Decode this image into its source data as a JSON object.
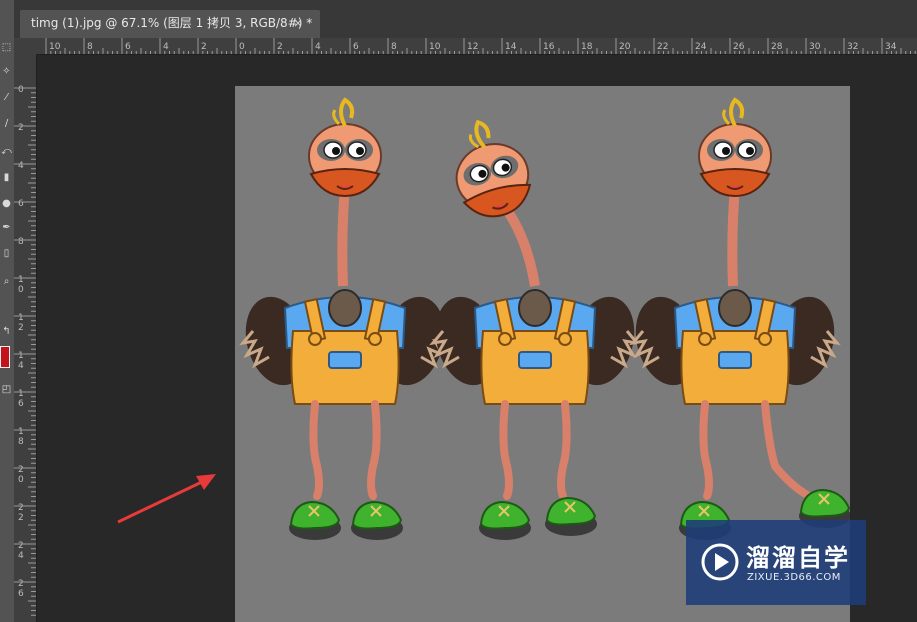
{
  "document_tab": {
    "title": "timg (1).jpg @ 67.1% (图层 1 拷贝 3, RGB/8#) *",
    "close_glyph": "×"
  },
  "ruler_h_labels": [
    "10",
    "8",
    "6",
    "4",
    "2",
    "0",
    "2",
    "4",
    "6",
    "8",
    "10",
    "12",
    "14",
    "16",
    "18",
    "20",
    "22",
    "24",
    "26",
    "28",
    "30",
    "32",
    "34"
  ],
  "ruler_v_labels": [
    "0",
    "2",
    "4",
    "6",
    "8",
    "10",
    "12",
    "14",
    "16",
    "18",
    "20",
    "22",
    "24",
    "26"
  ],
  "toolbar_icons": [
    "marquee-icon",
    "magic-wand-icon",
    "eyedropper-icon",
    "brush-icon",
    "history-brush-icon",
    "eraser-icon",
    "gradient-icon",
    "blur-icon",
    "pen-icon",
    "text-icon",
    "path-select-icon",
    "shape-icon",
    "zoom-icon",
    "swap-colors-icon",
    "quick-mask-icon"
  ],
  "watermark": {
    "title": "溜溜自学",
    "url": "ZIXUE.3D66.COM"
  },
  "colors": {
    "canvas_gray": "#7b7b7b",
    "arrow_red": "#e83a3a",
    "overall_orange": "#f3ad3a",
    "shirt_blue": "#5aa9f0",
    "shoe_green": "#3fb32e",
    "head_orange": "#ef9a72"
  }
}
